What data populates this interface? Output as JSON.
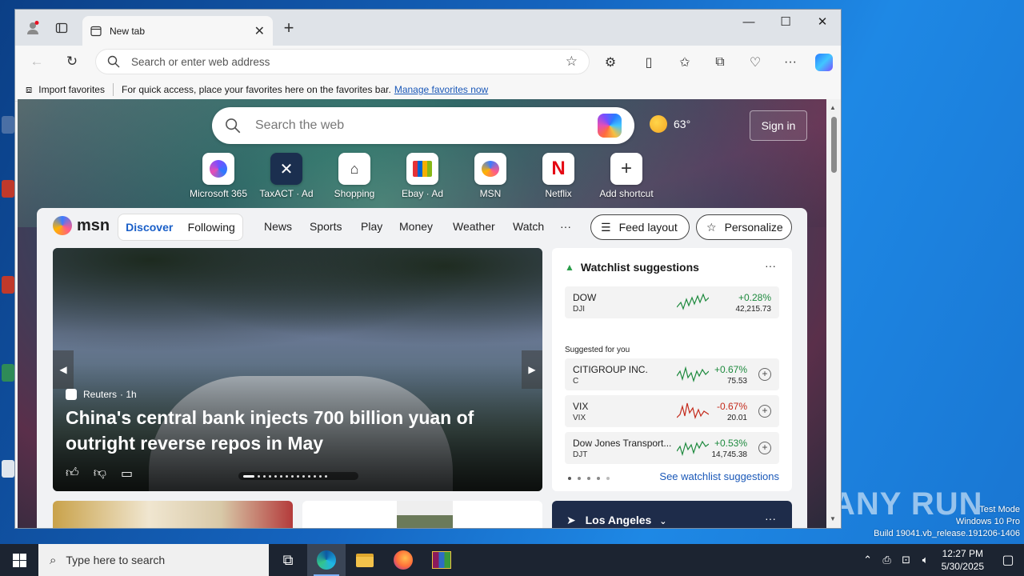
{
  "browser": {
    "tab_title": "New tab",
    "address_placeholder": "Search or enter web address",
    "favbar": {
      "import_label": "Import favorites",
      "hint": "For quick access, place your favorites here on the favorites bar.",
      "manage_link": "Manage favorites now"
    }
  },
  "newtab": {
    "search_placeholder": "Search the web",
    "weather_temp": "63°",
    "signin_label": "Sign in",
    "shortcuts": [
      {
        "label": "Microsoft 365",
        "icon": "microsoft365-icon"
      },
      {
        "label": "TaxACT · Ad",
        "icon": "taxact-icon"
      },
      {
        "label": "Shopping",
        "icon": "tag-icon"
      },
      {
        "label": "Ebay · Ad",
        "icon": "ebay-icon"
      },
      {
        "label": "MSN",
        "icon": "msn-icon"
      },
      {
        "label": "Netflix",
        "icon": "netflix-icon"
      },
      {
        "label": "Add shortcut",
        "icon": "plus-icon"
      }
    ]
  },
  "feed": {
    "logo": "msn",
    "tabs": [
      "Discover",
      "Following"
    ],
    "nav": [
      "News",
      "Sports",
      "Play",
      "Money",
      "Weather",
      "Watch",
      "···"
    ],
    "feed_layout_label": "Feed layout",
    "personalize_label": "Personalize",
    "hero": {
      "source": "Reuters",
      "age": "· 1h",
      "headline": "China's central bank injects 700 billion yuan of outright reverse repos in May"
    },
    "watchlist": {
      "title": "Watchlist suggestions",
      "suggested_label": "Suggested for you",
      "see_all": "See watchlist suggestions",
      "stocks": [
        {
          "name": "DOW",
          "ticker": "DJI",
          "change": "+0.28%",
          "price": "42,215.73",
          "direction": "up"
        },
        {
          "name": "CITIGROUP INC.",
          "ticker": "C",
          "change": "+0.67%",
          "price": "75.53",
          "direction": "up"
        },
        {
          "name": "VIX",
          "ticker": "VIX",
          "change": "-0.67%",
          "price": "20.01",
          "direction": "down"
        },
        {
          "name": "Dow Jones Transport...",
          "ticker": "DJT",
          "change": "+0.53%",
          "price": "14,745.38",
          "direction": "up"
        }
      ]
    },
    "weather_card": {
      "location": "Los Angeles"
    }
  },
  "desktop": {
    "watermark_lines": [
      "Test Mode",
      "Windows 10 Pro",
      "Build 19041.vb_release.191206-1406"
    ],
    "anyrun": "ANY RUN"
  },
  "taskbar": {
    "search_placeholder": "Type here to search",
    "time": "12:27 PM",
    "date": "5/30/2025"
  },
  "colors": {
    "accent": "#1a5fc8",
    "up": "#1e8a3e",
    "down": "#c42b1c",
    "taskbar": "#1c2431"
  }
}
